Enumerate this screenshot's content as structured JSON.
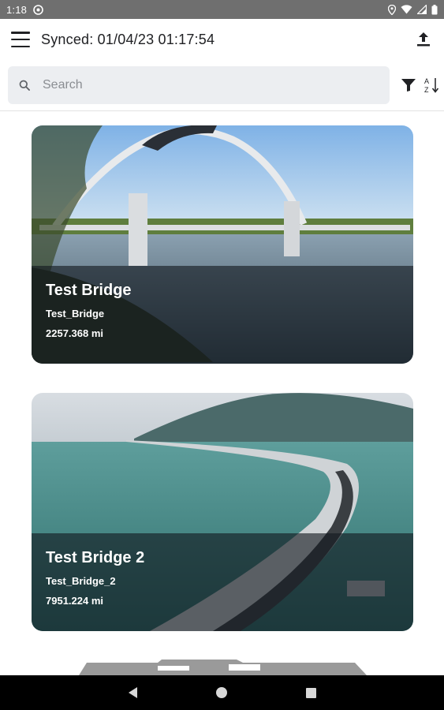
{
  "status_bar": {
    "time": "1:18",
    "icons": [
      "at-icon",
      "location-icon",
      "wifi-icon",
      "signal-icon",
      "battery-icon"
    ]
  },
  "app_bar": {
    "title": "Synced: 01/04/23 01:17:54",
    "icons": [
      "menu-icon",
      "upload-icon"
    ]
  },
  "search": {
    "placeholder": "Search",
    "value": "",
    "icons": [
      "search-icon",
      "filter-icon",
      "sort-az-icon"
    ]
  },
  "bridges": [
    {
      "name": "Test Bridge",
      "code": "Test_Bridge",
      "distance": "2257.368 mi"
    },
    {
      "name": "Test Bridge 2",
      "code": "Test_Bridge_2",
      "distance": "7951.224 mi"
    }
  ],
  "colors": {
    "status_bar": "#6f6f6f",
    "search_background": "#eceef1",
    "card_overlay": "#12181e",
    "nav_bar": "#000000"
  },
  "nav_bar": {
    "icons": [
      "back-icon",
      "home-icon",
      "recents-icon"
    ]
  }
}
